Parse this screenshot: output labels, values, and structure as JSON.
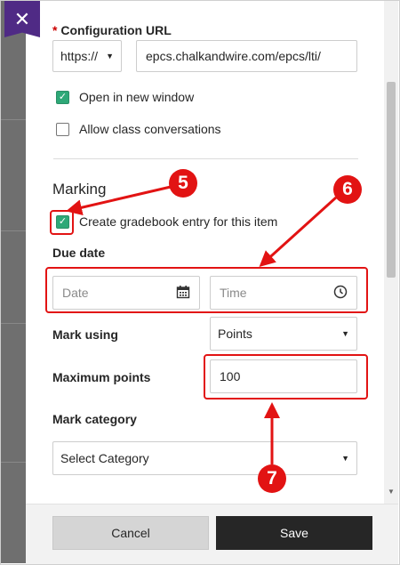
{
  "close": {
    "icon": "close-icon",
    "glyph": "✕"
  },
  "config_url": {
    "label": "Configuration URL",
    "required_mark": "*",
    "protocol": "https://",
    "url_value": "epcs.chalkandwire.com/epcs/lti/"
  },
  "options": {
    "open_new_window": {
      "label": "Open in new window",
      "checked": true
    },
    "allow_conversations": {
      "label": "Allow class conversations",
      "checked": false
    }
  },
  "marking": {
    "heading": "Marking",
    "gradebook": {
      "label": "Create gradebook entry for this item",
      "checked": true
    },
    "due_date": {
      "label": "Due date",
      "date_placeholder": "Date",
      "time_placeholder": "Time"
    },
    "mark_using": {
      "label": "Mark using",
      "value": "Points"
    },
    "max_points": {
      "label": "Maximum points",
      "value": "100"
    },
    "mark_category": {
      "label": "Mark category",
      "value": "Select Category"
    }
  },
  "footer": {
    "cancel_label": "Cancel",
    "save_label": "Save"
  },
  "annotations": {
    "badge_5": "5",
    "badge_6": "6",
    "badge_7": "7",
    "color": "#e21313"
  },
  "colors": {
    "accent_purple": "#4f2a85",
    "checkbox_green": "#2ea877",
    "save_button": "#262626"
  }
}
